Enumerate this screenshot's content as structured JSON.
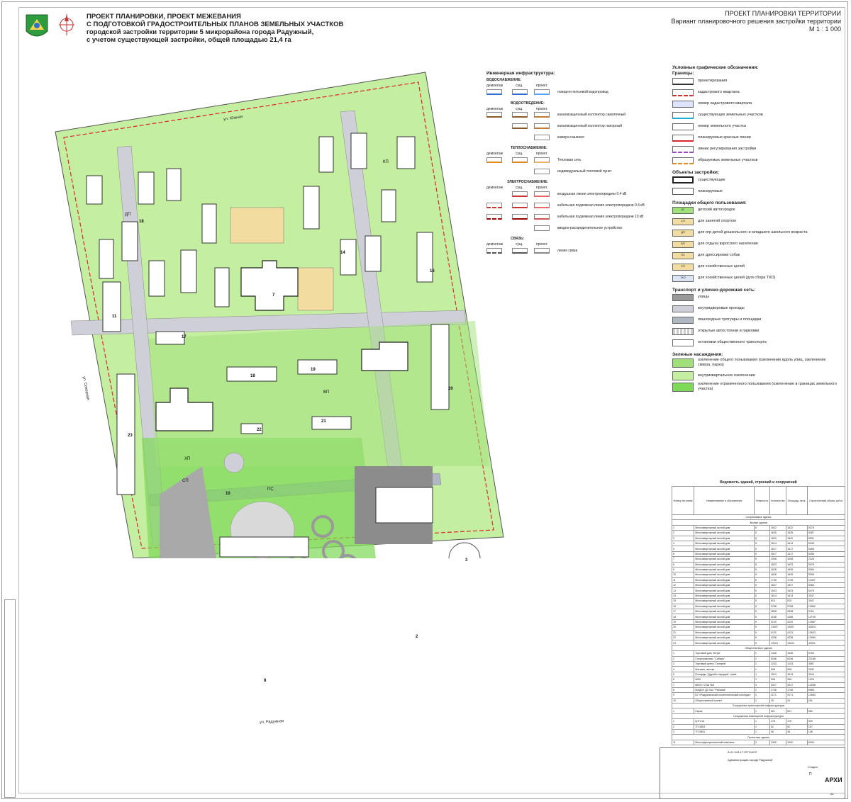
{
  "header": {
    "title_lines": [
      "ПРОЕКТ ПЛАНИРОВКИ, ПРОЕКТ МЕЖЕВАНИЯ",
      "С ПОДГОТОВКОЙ ГРАДОСТРОИТЕЛЬНЫХ ПЛАНОВ ЗЕМЕЛЬНЫХ УЧАСТКОВ",
      "городской застройки территории 5 микрорайона города Радужный,",
      "с учетом существующей застройки, общей площадью 21,4 га"
    ],
    "right_lines": [
      "ПРОЕКТ ПЛАНИРОВКИ ТЕРРИТОРИИ",
      "Вариант планировочного решения застройки территории",
      "М 1 : 1 000"
    ]
  },
  "streets": {
    "north": "ул. Южная",
    "south": "ул. Радужная",
    "west": "ул. Северная"
  },
  "map_numbers": [
    "1",
    "2",
    "3",
    "4",
    "5",
    "6",
    "7",
    "8",
    "9",
    "10",
    "11",
    "12",
    "13",
    "14",
    "15",
    "16",
    "17",
    "18",
    "19",
    "20",
    "21",
    "22",
    "23"
  ],
  "map_codes": {
    "dp": "ДП",
    "sp": "СП",
    "vp": "ВП",
    "hp": "ХП",
    "ps": "ПС",
    "kp": "КП"
  },
  "engineering_legend": {
    "title": "Инженерная инфраструктура:",
    "sections": [
      {
        "title": "ВОДОСНАБЖЕНИЕ:",
        "cols": [
          "демонтаж",
          "сущ.",
          "проект."
        ],
        "items": [
          "пожарно-питьевой водопровод"
        ]
      },
      {
        "title": "ВОДООТВЕДЕНИЕ:",
        "cols": [
          "демонтаж",
          "сущ.",
          "проект."
        ],
        "items": [
          "канализационный коллектор самотечный",
          "канализационный коллектор напорный",
          "камера гашения"
        ]
      },
      {
        "title": "ТЕПЛОСНАБЖЕНИЕ:",
        "cols": [
          "демонтаж",
          "сущ.",
          "проект."
        ],
        "items": [
          "Тепловая сеть",
          "индивидуальный тепловой пункт"
        ]
      },
      {
        "title": "ЭЛЕКТРОСНАБЖЕНИЕ:",
        "cols": [
          "демонтаж",
          "сущ.",
          "проект."
        ],
        "items": [
          "воздушная линия электропередачи 0.4 кВ",
          "кабельная подземная линия электропередачи 0.4 кВ",
          "кабельная подземная линия электропередачи 10 кВ",
          "вводно-распределительное устройство"
        ]
      },
      {
        "title": "СВЯЗЬ:",
        "cols": [
          "демонтаж",
          "сущ.",
          "проект."
        ],
        "items": [
          "линия связи"
        ]
      }
    ]
  },
  "symbols_legend": {
    "title": "Условные графические обозначения:",
    "groups": [
      {
        "title": "Границы:",
        "items": [
          "проектирования",
          "кадастрового квартала",
          "номер кадастрового квартала",
          "существующих земельных участков",
          "номер земельного участка",
          "планируемые красные линии",
          "линии регулирования застройки",
          "образуемых земельных участков"
        ]
      },
      {
        "title": "Объекты застройки:",
        "items": [
          "существующие",
          "планируемые"
        ]
      },
      {
        "title": "Площадки общего пользования:",
        "items": [
          "детский автогородок",
          "для занятий спортом",
          "для игр детей дошкольного и младшего школьного возраста",
          "для отдыха взрослого населения",
          "для дрессировки собак",
          "для хозяйственных целей",
          "для хозяйственных целей (для сбора ТКО)"
        ]
      },
      {
        "title": "Транспорт и улично-дорожная сеть:",
        "items": [
          "улицы",
          "внутридворовые проезды",
          "пешеходные тротуары и площадки",
          "открытые автостоянки и парковки",
          "остановки общественного транспорта"
        ]
      },
      {
        "title": "Зеленые насаждения:",
        "items": [
          "озеленение общего пользования (озеленение вдоль улиц, озеленение сквера, парка)",
          "внутриквартальное озеленение",
          "озеленение ограниченного пользования (озеленение в границах земельного участка)"
        ]
      }
    ],
    "codes": [
      "АГ",
      "СП",
      "ДП",
      "ВП",
      "ПС",
      "ХП",
      "ТКО"
    ]
  },
  "table": {
    "title": "Ведомость зданий, строений и сооружений",
    "headers": [
      "Номер на плане",
      "Наименование и обозначение",
      "Этажность",
      "Количество",
      "Площадь, кв.м.",
      "Строительный объем, куб.м."
    ],
    "sections": [
      "Сохраняемые здания",
      "Жилые здания",
      "Общественные здания",
      "Сооружения транспортной инфраструктуры",
      "Сооружения инженерной инфраструктуры",
      "Проектные здания"
    ],
    "rows": [
      [
        "1",
        "Многоквартирный жилой дом",
        "5",
        "1622",
        "1622",
        "5376"
      ],
      [
        "2",
        "Многоквартирный жилой дом",
        "5",
        "1626",
        "1626",
        "5387"
      ],
      [
        "3",
        "Многоквартирный жилой дом",
        "5",
        "1620",
        "1620",
        "5391"
      ],
      [
        "4",
        "Многоквартирный жилой дом",
        "5",
        "1614",
        "1614",
        "5345"
      ],
      [
        "5",
        "Многоквартирный жилой дом",
        "5",
        "1617",
        "1617",
        "5356"
      ],
      [
        "6",
        "Многоквартирный жилой дом",
        "5",
        "1617",
        "1617",
        "5356"
      ],
      [
        "7",
        "Многоквартирный жилой дом",
        "5",
        "1008",
        "1008",
        "2328"
      ],
      [
        "8",
        "Многоквартирный жилой дом",
        "5",
        "1623",
        "1623",
        "5376"
      ],
      [
        "9",
        "Многоквартирный жилой дом",
        "5",
        "1626",
        "1626",
        "5384"
      ],
      [
        "10",
        "Многоквартирный жилой дом",
        "5",
        "1626",
        "1626",
        "5395"
      ],
      [
        "11",
        "Многоквартирный жилой дом",
        "6",
        "1745",
        "1745",
        "11357"
      ],
      [
        "12",
        "Многоквартирный жилой дом",
        "5",
        "1627",
        "1627",
        "5384"
      ],
      [
        "13",
        "Многоквартирный жилой дом",
        "5",
        "1623",
        "1623",
        "5376"
      ],
      [
        "14",
        "Многоквартирный жилой дом",
        "5",
        "1614",
        "1614",
        "3347"
      ],
      [
        "15",
        "Многоквартирный жилой дом",
        "5",
        "815",
        "815",
        "3047"
      ],
      [
        "16",
        "Многоквартирный жилой дом",
        "9",
        "3758",
        "3758",
        "12862"
      ],
      [
        "17",
        "Многоквартирный жилой дом",
        "5",
        "2838",
        "2838",
        "9761"
      ],
      [
        "18",
        "Многоквартирный жилой дом",
        "9",
        "4166",
        "4166",
        "13749"
      ],
      [
        "19",
        "Многоквартирный жилой дом",
        "9",
        "4120",
        "4120",
        "13587"
      ],
      [
        "20",
        "Многоквартирный жилой дом",
        "9",
        "13007",
        "13007",
        "42824"
      ],
      [
        "21",
        "Многоквартирный жилой дом",
        "9",
        "4131",
        "4131",
        "13633"
      ],
      [
        "22",
        "Многоквартирный жилой дом",
        "9",
        "4238",
        "4238",
        "13984"
      ],
      [
        "23",
        "Многоквартирный жилой дом",
        "9",
        "13024",
        "13024",
        "42921"
      ],
      [
        "1",
        "Торговый дом \"Югра\"",
        "2",
        "1440",
        "1440",
        "5760"
      ],
      [
        "2",
        "Спорткомплекс \"Сибирь\"",
        "2",
        "5246",
        "5246",
        "22185"
      ],
      [
        "3",
        "Торговый центр \"Галерея\"",
        "1",
        "1243",
        "1243",
        "3067"
      ],
      [
        "4",
        "Магазин, аптека",
        "1",
        "508",
        "508",
        "2632"
      ],
      [
        "5",
        "Площадь \"Дружбы народов\", храм",
        "1",
        "1513",
        "1513",
        "4244"
      ],
      [
        "6",
        "ЖКХ",
        "1",
        "306",
        "306",
        "1224"
      ],
      [
        "7",
        "МБОУ СОШ №6",
        "3",
        "3317",
        "3317",
        "13268"
      ],
      [
        "8",
        "МАДОУ ДС №2 \"Рябинка\"",
        "2",
        "1746",
        "1746",
        "6985"
      ],
      [
        "9",
        "БУ «Радужнинский политехнический колледж»",
        "3",
        "3171",
        "3171",
        "12683"
      ],
      [
        "10",
        "Общественный туалет",
        "1",
        "20",
        "20",
        "291"
      ],
      [
        "1",
        "Гараж",
        "1",
        "521",
        "521",
        "962"
      ],
      [
        "1",
        "ЦТП-16",
        "1",
        "176",
        "176",
        "929"
      ],
      [
        "2",
        "ТП-9853",
        "1",
        "52",
        "52",
        "157"
      ],
      [
        "3",
        "ТП-9851",
        "1",
        "46",
        "46",
        "148"
      ],
      [
        "11",
        "Многофункциональный комплекс",
        "2",
        "1000",
        "1000",
        "6000"
      ]
    ]
  },
  "stamp": {
    "code": "А-01 043-17-ППТ.МОП",
    "client": "Администрация города Радужный",
    "company": "АРХИ",
    "sheet_label": "Стадия",
    "sheet": "П",
    "format": "А1"
  },
  "colors": {
    "green_public": "#7ed957",
    "green_inner": "#c4efa0",
    "green_limited": "#9fe07a",
    "road": "#cfcfd8",
    "walk": "#aeb7c2",
    "building": "#ffffff",
    "site": "#f2dca0",
    "parking": "#8c8c8c",
    "red_line": "#d9262e"
  }
}
